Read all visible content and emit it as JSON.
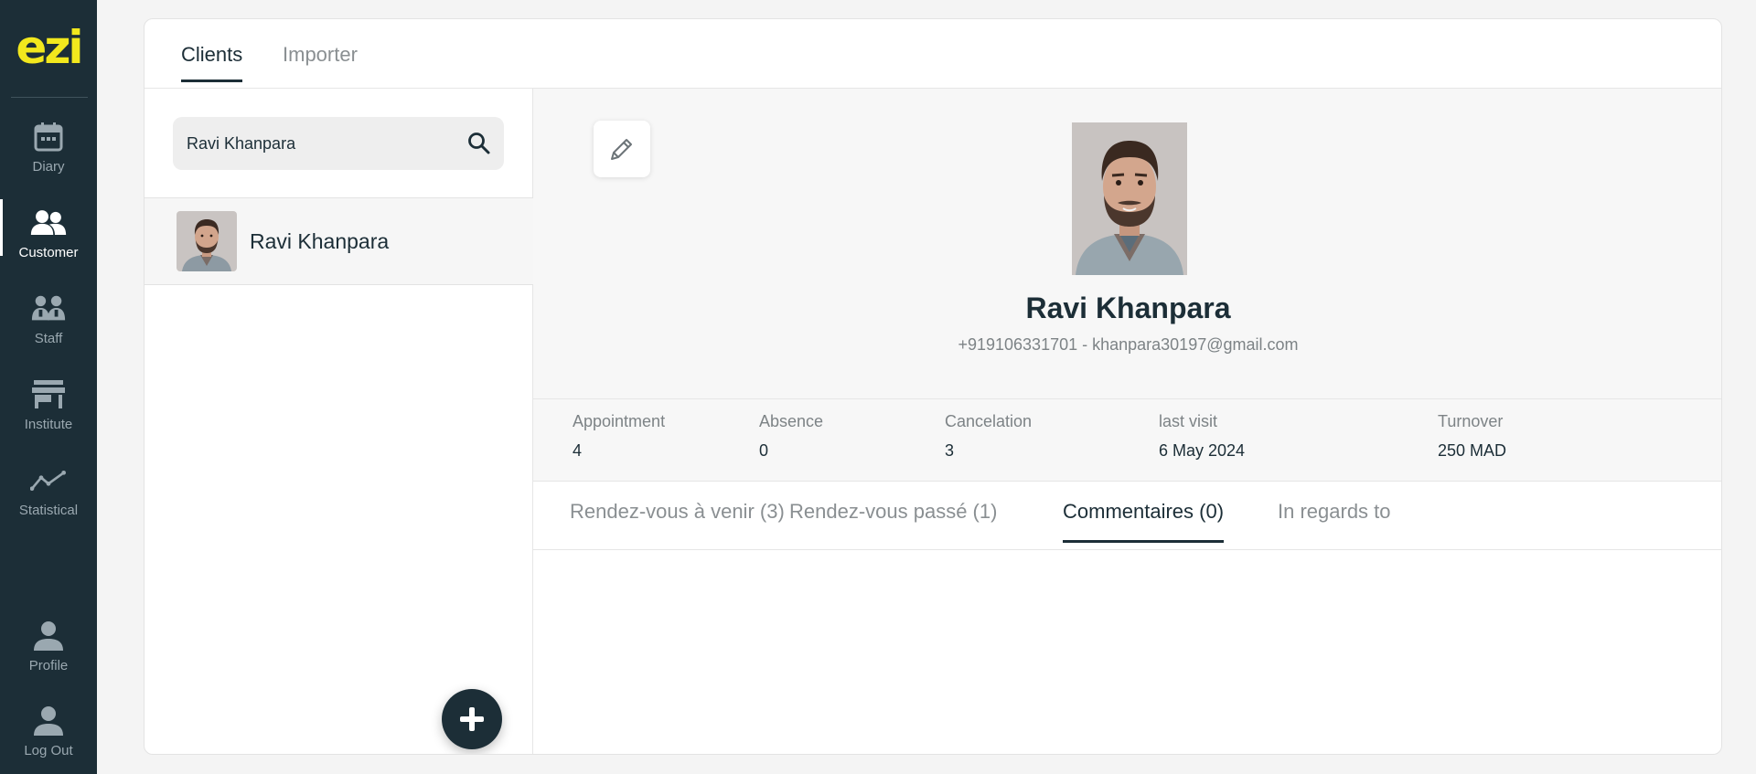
{
  "app": {
    "logo_text": "ezi",
    "brand_color": "#f2e81d",
    "sidebar_color": "#1c2e37"
  },
  "sidebar": {
    "items": [
      {
        "label": "Diary",
        "icon": "calendar-icon",
        "active": false
      },
      {
        "label": "Customer",
        "icon": "users-icon",
        "active": true
      },
      {
        "label": "Staff",
        "icon": "staff-icon",
        "active": false
      },
      {
        "label": "Institute",
        "icon": "store-icon",
        "active": false
      },
      {
        "label": "Statistical",
        "icon": "chart-line-icon",
        "active": false
      }
    ],
    "bottom_items": [
      {
        "label": "Profile",
        "icon": "user-icon"
      },
      {
        "label": "Log Out",
        "icon": "user-icon"
      }
    ]
  },
  "top_tabs": [
    {
      "label": "Clients",
      "active": true
    },
    {
      "label": "Importer",
      "active": false
    }
  ],
  "search": {
    "value": "Ravi Khanpara",
    "placeholder": ""
  },
  "client_list": [
    {
      "name": "Ravi Khanpara"
    }
  ],
  "profile": {
    "name": "Ravi Khanpara",
    "contact": "+919106331701 - khanpara30197@gmail.com"
  },
  "stats": [
    {
      "label": "Appointment",
      "value": "4"
    },
    {
      "label": "Absence",
      "value": "0"
    },
    {
      "label": "Cancelation",
      "value": "3"
    },
    {
      "label": "last visit",
      "value": "6 May 2024"
    },
    {
      "label": "Turnover",
      "value": "250 MAD"
    }
  ],
  "sub_tabs": [
    {
      "label": "Rendez-vous à venir (3)",
      "active": false
    },
    {
      "label": "Rendez-vous passé (1)",
      "active": false
    },
    {
      "label": "Commentaires (0)",
      "active": true
    },
    {
      "label": "In regards to",
      "active": false
    }
  ]
}
